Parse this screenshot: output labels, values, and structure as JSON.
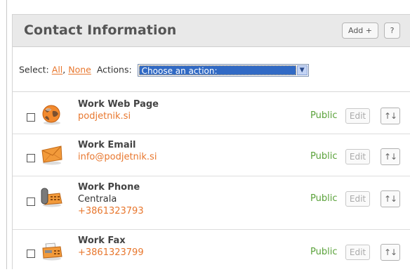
{
  "panel": {
    "title": "Contact Information",
    "add_label": "Add +",
    "help_label": "?"
  },
  "selectbar": {
    "select_label": "Select:",
    "all_label": "All",
    "separator": ",",
    "none_label": "None",
    "actions_label": "Actions:",
    "action_value": "Choose an action:"
  },
  "items": [
    {
      "name": "Work Web Page",
      "lines": [
        "podjetnik.si"
      ],
      "visibility": "Public",
      "edit_label": "Edit",
      "sort_label": "↑↓",
      "icon": "globe-icon"
    },
    {
      "name": "Work Email",
      "lines": [
        "info@podjetnik.si"
      ],
      "visibility": "Public",
      "edit_label": "Edit",
      "sort_label": "↑↓",
      "icon": "envelope-icon"
    },
    {
      "name": "Work Phone",
      "lines": [
        "Centrala",
        "+3861323793"
      ],
      "visibility": "Public",
      "edit_label": "Edit",
      "sort_label": "↑↓",
      "icon": "phone-icon"
    },
    {
      "name": "Work Fax",
      "lines": [
        "+3861323799"
      ],
      "visibility": "Public",
      "edit_label": "Edit",
      "sort_label": "↑↓",
      "icon": "fax-icon"
    }
  ],
  "colors": {
    "accent_orange": "#e8772e",
    "public_green": "#5aa23a",
    "selection_blue": "#316ac5"
  }
}
